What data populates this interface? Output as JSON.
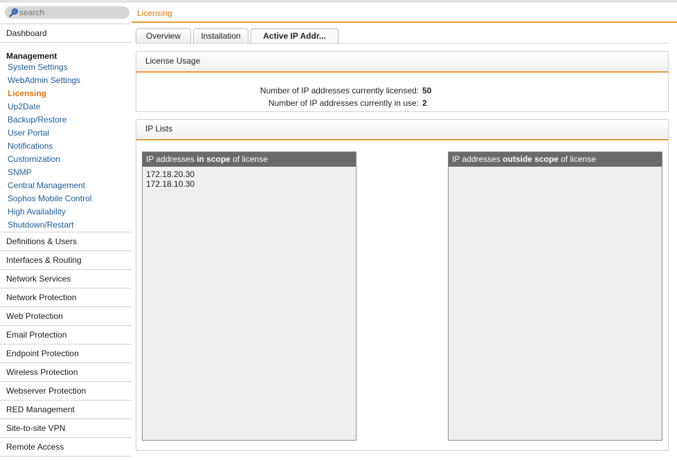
{
  "search": {
    "placeholder": "search"
  },
  "sidebar": {
    "dashboard": "Dashboard",
    "management_title": "Management",
    "management_items": [
      "System Settings",
      "WebAdmin Settings",
      "Licensing",
      "Up2Date",
      "Backup/Restore",
      "User Portal",
      "Notifications",
      "Customization",
      "SNMP",
      "Central Management",
      "Sophos Mobile Control",
      "High Availability",
      "Shutdown/Restart"
    ],
    "sections": [
      "Definitions & Users",
      "Interfaces & Routing",
      "Network Services",
      "Network Protection",
      "Web Protection",
      "Email Protection",
      "Endpoint Protection",
      "Wireless Protection",
      "Webserver Protection",
      "RED Management",
      "Site-to-site VPN",
      "Remote Access"
    ]
  },
  "header": {
    "title": "Licensing"
  },
  "tabs": [
    "Overview",
    "Installation",
    "Active IP Addr..."
  ],
  "license_usage": {
    "title": "License Usage",
    "licensed_label": "Number of IP addresses currently licensed:",
    "licensed_value": "50",
    "in_use_label": "Number of IP addresses currently in use:",
    "in_use_value": "2"
  },
  "ip_lists": {
    "title": "IP Lists",
    "in_scope": {
      "title_prefix": "IP addresses ",
      "title_bold": "in scope",
      "title_suffix": " of license",
      "items": [
        "172.18.20.30",
        "172.18.10.30"
      ]
    },
    "out_scope": {
      "title_prefix": "IP addresses ",
      "title_bold": "outside scope",
      "title_suffix": " of license",
      "items": []
    }
  },
  "colors": {
    "accent": "#e07a10",
    "link": "#1f5a93",
    "list_header": "#6a6a6a"
  }
}
